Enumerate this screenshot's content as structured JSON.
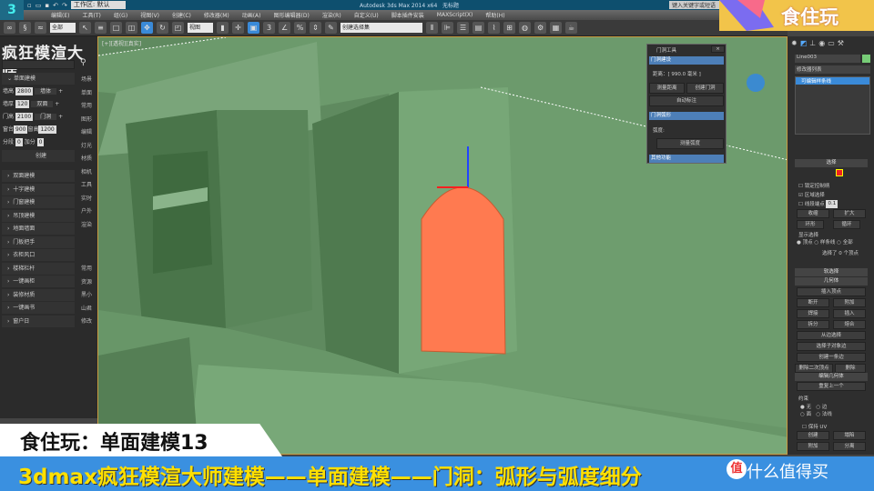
{
  "app": {
    "title": "Autodesk 3ds Max 2014 x64",
    "doc": "无标题",
    "workspace": "工作区: 默认",
    "search_placeholder": "键入关键字或短语"
  },
  "menu": [
    "编辑(E)",
    "工具(T)",
    "组(G)",
    "视图(V)",
    "创建(C)",
    "修改器(M)",
    "动画(A)",
    "图形编辑器(D)",
    "渲染(R)",
    "自定义(U)",
    "脚本插件安装",
    "MAXScript(X)",
    "帮助(H)"
  ],
  "toolbar": {
    "selection_filter": "全部",
    "ref_coord": "视图",
    "named_selection": "创建选择集"
  },
  "left_panel": {
    "title": "疯狂模渲大师",
    "section": "单面建模",
    "fields": [
      {
        "label": "墙高",
        "value": "2800",
        "btn": "墙体"
      },
      {
        "label": "墙厚",
        "value": "120",
        "btn": "双面"
      },
      {
        "label": "门高",
        "value": "2100",
        "btn": "门洞"
      }
    ],
    "row4": {
      "l1": "窗台",
      "v1": "900",
      "l2": "窗高",
      "v2": "1200"
    },
    "row5": {
      "l1": "分段",
      "v1": "0",
      "l2": "加分",
      "v2": "0"
    },
    "create": "创建",
    "sections": [
      "双面建模",
      "十字建模",
      "门窗建模",
      "吊顶建模",
      "地面墙面",
      "门板把手",
      "衣柜风口",
      "楼梯栏杆",
      "一键画柜",
      "装修材质",
      "一键画书",
      "窗户日"
    ],
    "tabs": [
      "场景",
      "单面",
      "常用",
      "图形",
      "编辑",
      "灯光",
      "材质",
      "相机",
      "工具",
      "实时",
      "户外",
      "渲染",
      "常用",
      "资源",
      "黑小",
      "山君",
      "修改"
    ]
  },
  "viewport": {
    "label": "[+][透视][真实]"
  },
  "dialog": {
    "title": "门洞工具",
    "sec1": "门洞建设",
    "distance": "距离：[ 990.0 毫米 ]",
    "measure": "测量距离",
    "create": "创建门洞",
    "auto": "自动标注",
    "sec2": "门洞弧形",
    "arc": "弧度:",
    "measure_arc": "测量弧度",
    "sec3": "其他功能"
  },
  "right_panel": {
    "object_name": "Line003",
    "modifier_list": "修改器列表",
    "stack_item": "可编辑样条线",
    "rollout_select": "选择",
    "lock_handles": "锁定控制柄",
    "area_select": "区域选择",
    "segment_end": "线段端点",
    "area_value": "0.1",
    "shrink": "收缩",
    "grow": "扩大",
    "ring": "环形",
    "loop": "循环",
    "display": "显示选择",
    "radio": [
      "顶点",
      "样条线",
      "全部"
    ],
    "sel_status": "选择了 0 个顶点",
    "soft": "软选择",
    "geometry": "几何体",
    "insert_vertex": "插入顶点",
    "btns": [
      "断开",
      "附加",
      "焊接",
      "插入",
      "拆分",
      "熔合",
      "从边选择",
      "选择子对象边",
      "创建一条边",
      "删除二次顶点",
      "删除"
    ],
    "edit_geo": "编辑几何体",
    "create_btn": "重复上一个",
    "constraints": "约束",
    "cons": [
      "无",
      "边",
      "面",
      "法线"
    ],
    "keep_uv": "保持 UV",
    "create2": "创建",
    "collapse": "塌陷",
    "attach": "附加",
    "detach": "分离"
  },
  "overlay": {
    "brand": "食住玩",
    "caption1": "食住玩：单面建模13",
    "caption2": "3dmax疯狂模渲大师建模——单面建模——门洞：弧形与弧度细分",
    "watermark": "什么值得买",
    "watermark_icon": "值"
  },
  "colors": {
    "door": "#ff7a50",
    "scene": "#5f8a5f",
    "accent": "#3a8ad8",
    "caption_bg": "#3a90e0",
    "caption_text": "#ffe000"
  }
}
